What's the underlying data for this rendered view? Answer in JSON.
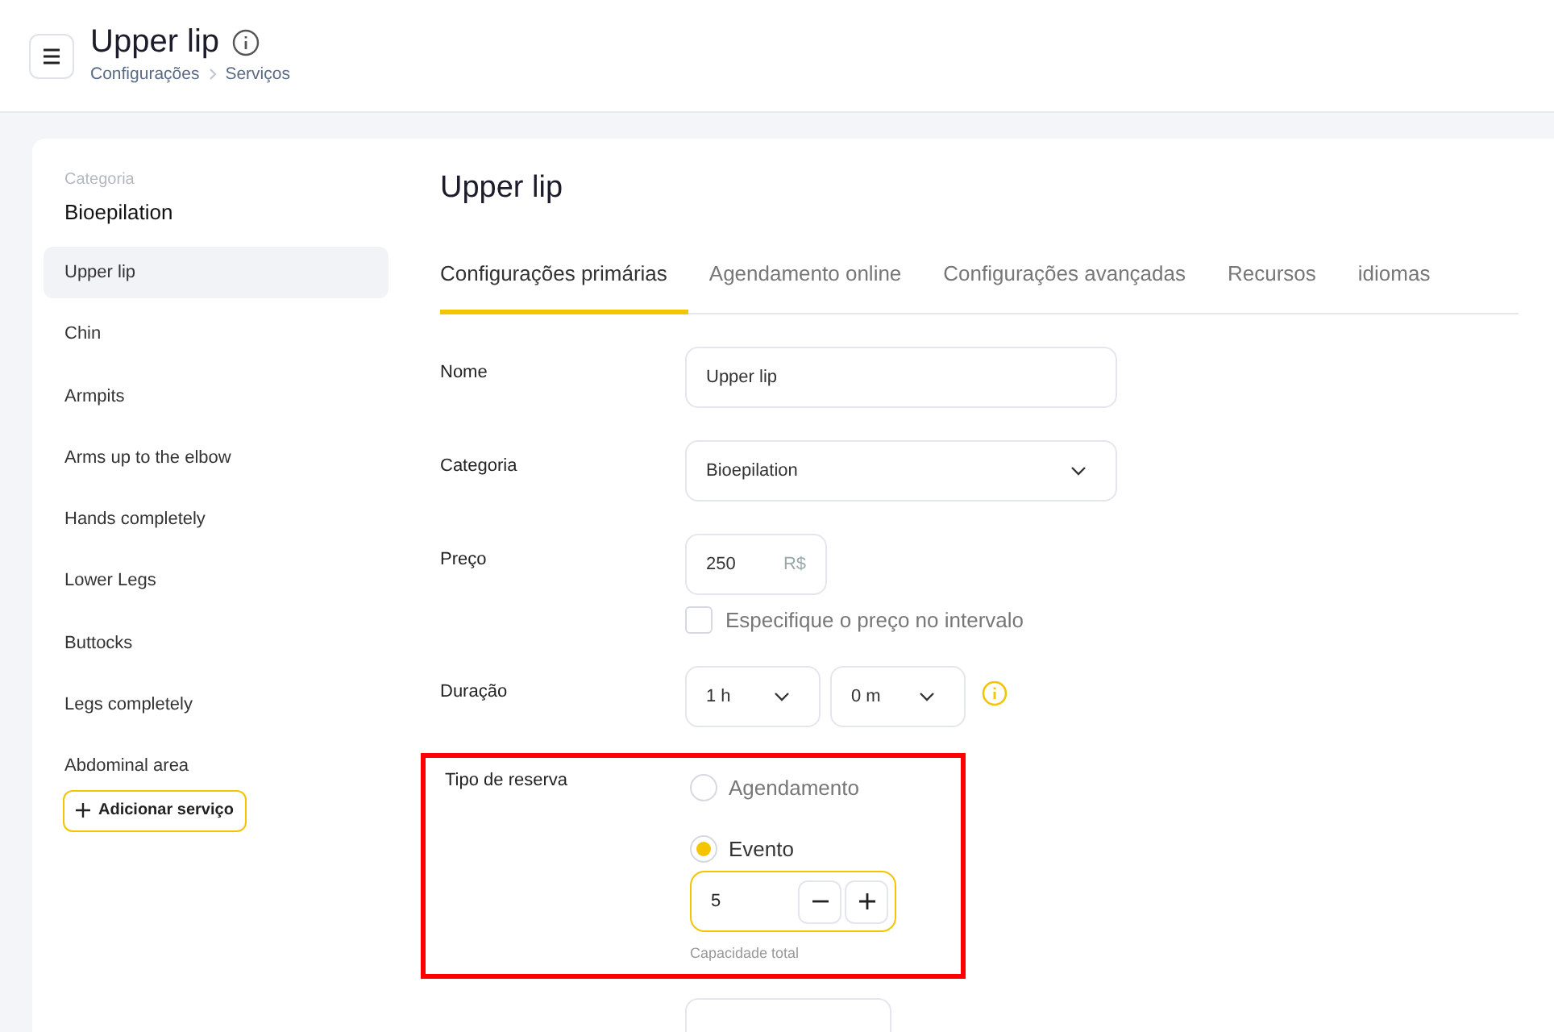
{
  "header": {
    "title": "Upper lip",
    "breadcrumb": [
      "Configurações",
      "Serviços"
    ]
  },
  "sidebar": {
    "category_label": "Categoria",
    "category_name": "Bioepilation",
    "items": [
      {
        "label": "Upper lip",
        "selected": true
      },
      {
        "label": "Chin",
        "selected": false
      },
      {
        "label": "Armpits",
        "selected": false
      },
      {
        "label": "Arms up to the elbow",
        "selected": false
      },
      {
        "label": "Hands completely",
        "selected": false
      },
      {
        "label": "Lower Legs",
        "selected": false
      },
      {
        "label": "Buttocks",
        "selected": false
      },
      {
        "label": "Legs completely",
        "selected": false
      },
      {
        "label": "Abdominal area",
        "selected": false
      }
    ],
    "add_button": "Adicionar serviço"
  },
  "main": {
    "title": "Upper lip",
    "tabs": [
      {
        "label": "Configurações primárias",
        "selected": true
      },
      {
        "label": "Agendamento online",
        "selected": false
      },
      {
        "label": "Configurações avançadas",
        "selected": false
      },
      {
        "label": "Recursos",
        "selected": false
      },
      {
        "label": "idiomas",
        "selected": false
      }
    ],
    "form": {
      "name": {
        "label": "Nome",
        "value": "Upper lip"
      },
      "category": {
        "label": "Categoria",
        "value": "Bioepilation"
      },
      "price": {
        "label": "Preço",
        "value": "250",
        "currency": "R$"
      },
      "price_range": {
        "label": "Especifique o preço no intervalo",
        "checked": false
      },
      "duration": {
        "label": "Duração",
        "hours": "1 h",
        "minutes": "0 m"
      },
      "booking_type": {
        "label": "Tipo de reserva",
        "highlighted": true,
        "options": [
          {
            "label": "Agendamento",
            "selected": false
          },
          {
            "label": "Evento",
            "selected": true
          }
        ],
        "capacity": {
          "value": "5",
          "caption": "Capacidade total"
        }
      }
    }
  }
}
